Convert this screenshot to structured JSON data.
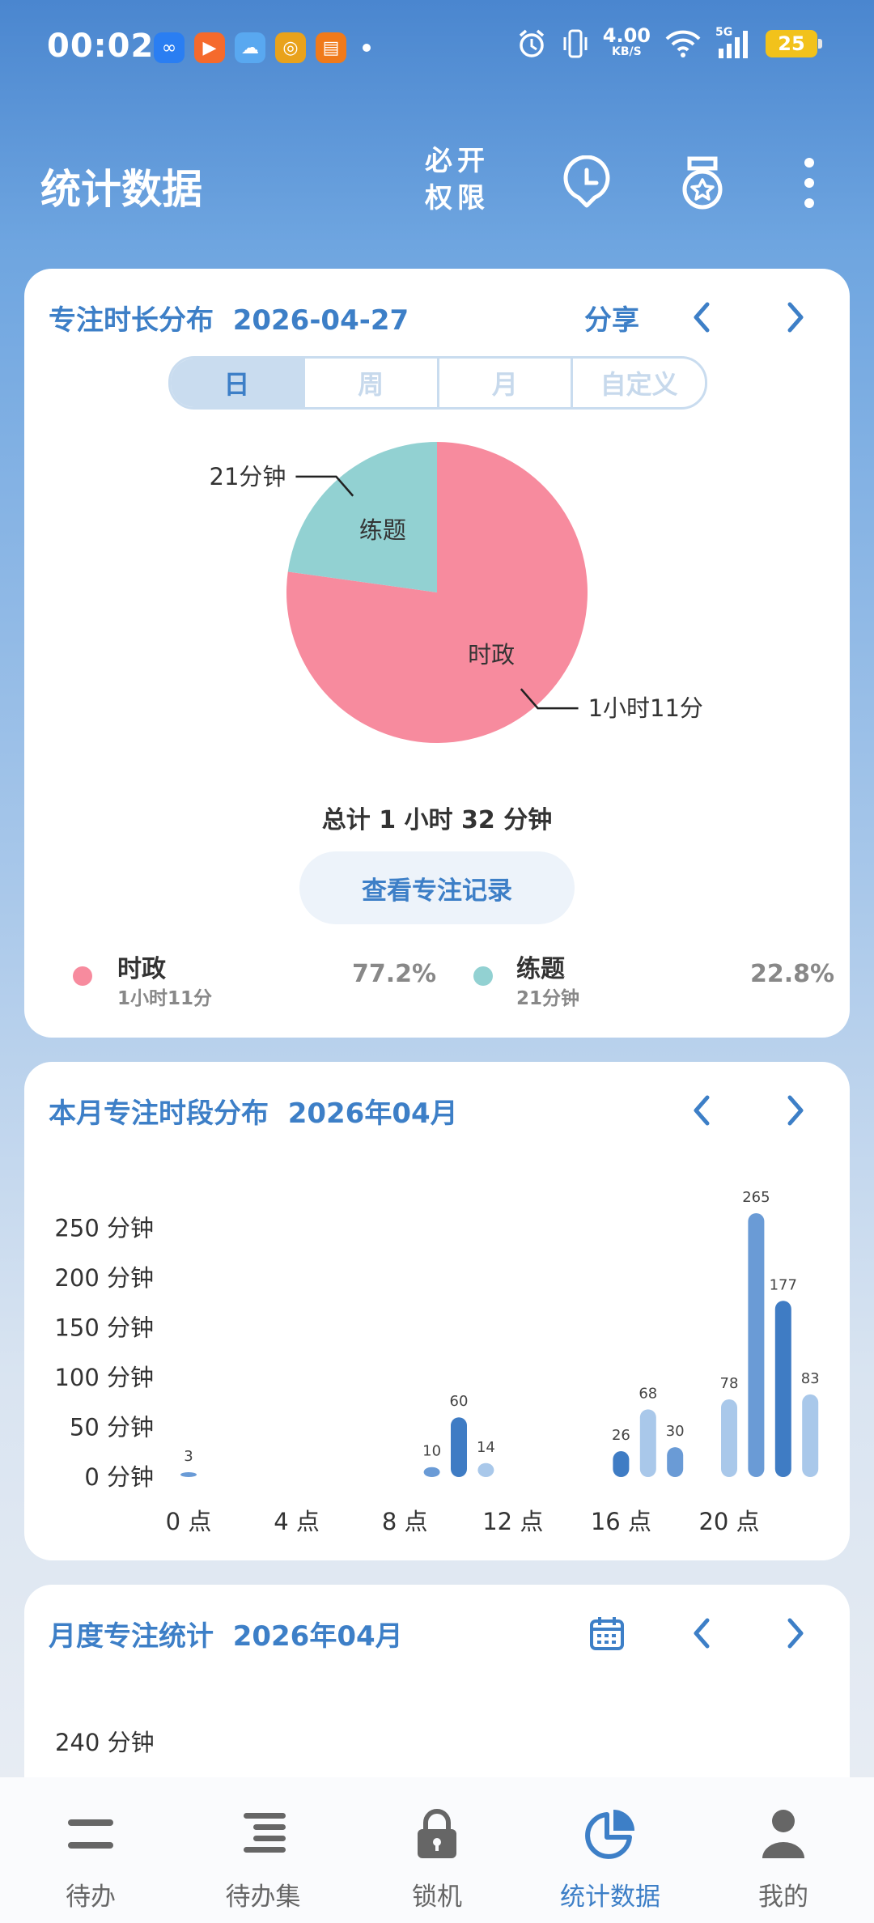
{
  "status_bar": {
    "time": "00:02",
    "net_speed_value": "4.00",
    "net_speed_unit": "KB/S",
    "signal_label": "5G",
    "battery": "25"
  },
  "app_bar": {
    "title": "统计数据",
    "permission_line1": "必开",
    "permission_line2": "权限"
  },
  "focus_card": {
    "title": "专注时长分布",
    "date": "2026-04-27",
    "share_label": "分享",
    "segments": [
      "日",
      "周",
      "月",
      "自定义"
    ],
    "total_text": "总计 1 小时 32 分钟",
    "record_button": "查看专注记录",
    "legend": [
      {
        "name": "时政",
        "duration": "1小时11分",
        "percent": "77.2%",
        "color": "#f78b9e"
      },
      {
        "name": "练题",
        "duration": "21分钟",
        "percent": "22.8%",
        "color": "#92d1d2"
      }
    ]
  },
  "chart_data": [
    {
      "type": "pie",
      "labels": [
        "时政",
        "练题"
      ],
      "values": [
        77.2,
        22.8
      ],
      "value_labels": [
        "1小时11分",
        "21分钟"
      ],
      "colors": [
        "#f78b9e",
        "#92d1d2"
      ]
    },
    {
      "type": "bar",
      "title": "本月专注时段分布",
      "date": "2026年04月",
      "hours": [
        0,
        9,
        10,
        11,
        16,
        17,
        18,
        20,
        21,
        22,
        23
      ],
      "values": [
        3,
        10,
        60,
        14,
        26,
        68,
        30,
        78,
        265,
        177,
        83
      ],
      "ytick_labels": [
        "0 分钟",
        "50 分钟",
        "100 分钟",
        "150 分钟",
        "200 分钟",
        "250 分钟"
      ],
      "xtick_labels": [
        "0 点",
        "4 点",
        "8 点",
        "12 点",
        "16 点",
        "20 点"
      ],
      "ylim": [
        0,
        265
      ]
    }
  ],
  "hourly_card": {
    "title": "本月专注时段分布",
    "date": "2026年04月"
  },
  "monthly_card": {
    "title": "月度专注统计",
    "date": "2026年04月",
    "first_tick": "240 分钟"
  },
  "bottom_nav": [
    {
      "label": "待办",
      "icon": "todo-list-icon"
    },
    {
      "label": "待办集",
      "icon": "todo-set-icon"
    },
    {
      "label": "锁机",
      "icon": "lock-icon"
    },
    {
      "label": "统计数据",
      "icon": "pie-chart-icon"
    },
    {
      "label": "我的",
      "icon": "person-icon"
    }
  ],
  "accent_color": "#3d7fc7"
}
